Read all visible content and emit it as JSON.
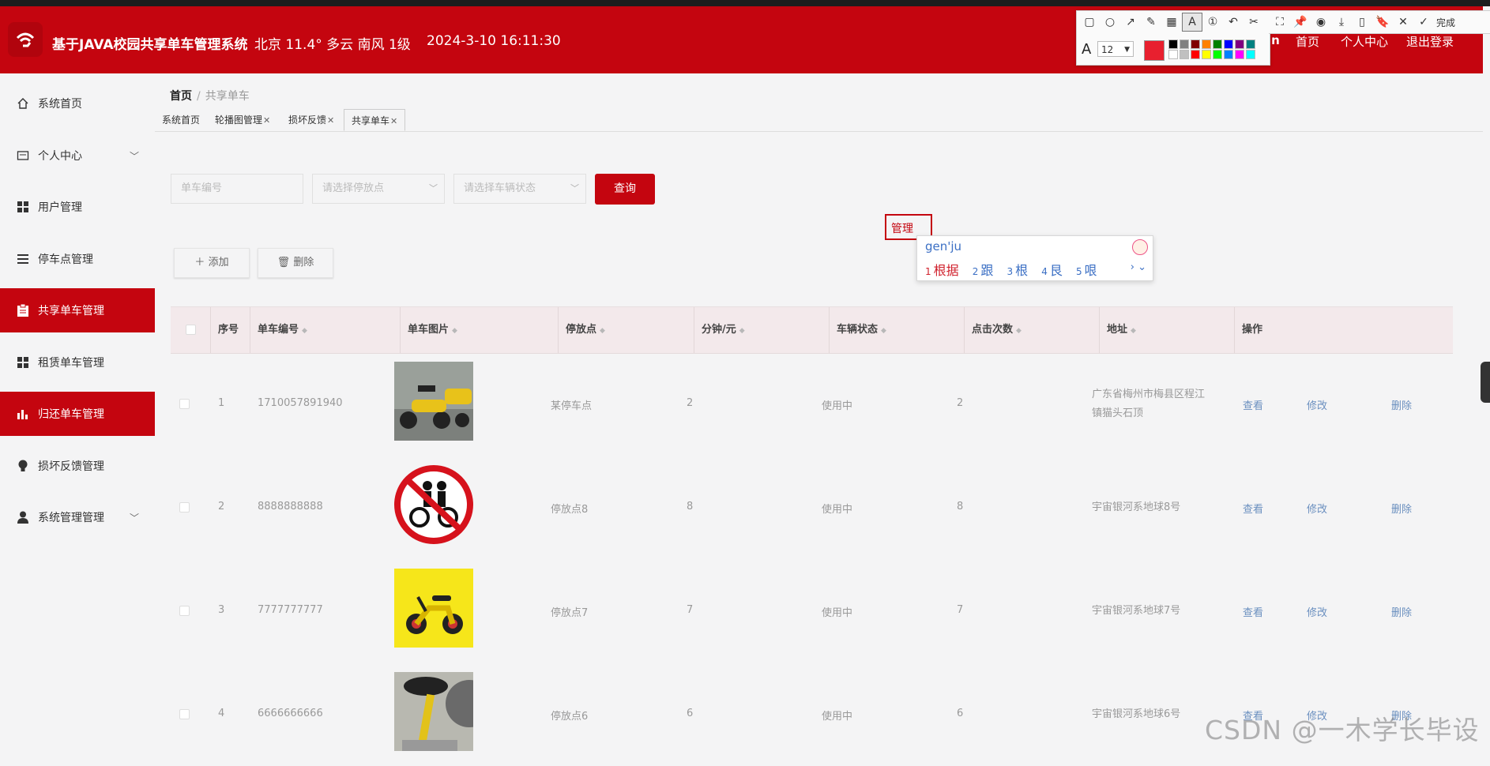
{
  "header": {
    "title": "基于JAVA校园共享单车管理系统",
    "weather": "北京  11.4°  多云  南风  1级",
    "datetime": "2024-3-10 16:11:30",
    "user_partial": "in",
    "nav": [
      "首页",
      "个人中心",
      "退出登录"
    ],
    "colors": {
      "brand": "#c4050f"
    }
  },
  "snip_tool": {
    "font_size": "12",
    "done_label": "完成",
    "current_color": "#e8202f",
    "palette": [
      "#000000",
      "#808080",
      "#800000",
      "#ff8000",
      "#008000",
      "#0000ff",
      "#800080",
      "#008080",
      "#ffffff",
      "#c0c0c0",
      "#ff0000",
      "#ffff00",
      "#00ff00",
      "#0080ff",
      "#ff00ff",
      "#00ffff"
    ]
  },
  "sidebar": {
    "items": [
      {
        "label": "系统首页",
        "icon": "home-icon"
      },
      {
        "label": "个人中心",
        "icon": "id-card-icon"
      },
      {
        "label": "用户管理",
        "icon": "grid-icon"
      },
      {
        "label": "停车点管理",
        "icon": "list-icon"
      },
      {
        "label": "共享单车管理",
        "icon": "clipboard-icon"
      },
      {
        "label": "租赁单车管理",
        "icon": "grid-icon"
      },
      {
        "label": "归还单车管理",
        "icon": "bar-chart-icon"
      },
      {
        "label": "损坏反馈管理",
        "icon": "bulb-icon"
      },
      {
        "label": "系统管理管理",
        "icon": "user-icon"
      }
    ]
  },
  "breadcrumb": {
    "home": "首页",
    "sep": "/",
    "current": "共享单车"
  },
  "tabs": [
    {
      "label": "系统首页"
    },
    {
      "label": "轮播图管理"
    },
    {
      "label": "损坏反馈"
    },
    {
      "label": "共享单车"
    }
  ],
  "search": {
    "bike_no_placeholder": "单车编号",
    "parking_placeholder": "请选择停放点",
    "status_placeholder": "请选择车辆状态",
    "query_label": "查询"
  },
  "actions": {
    "add_label": "添加",
    "delete_label": "删除"
  },
  "ime": {
    "composing": "管理",
    "pinyin": "gen'ju",
    "candidates": [
      {
        "n": "1",
        "text": "根据"
      },
      {
        "n": "2",
        "text": "跟"
      },
      {
        "n": "3",
        "text": "根"
      },
      {
        "n": "4",
        "text": "艮"
      },
      {
        "n": "5",
        "text": "哏"
      }
    ]
  },
  "table": {
    "headers": [
      "序号",
      "单车编号",
      "单车图片",
      "停放点",
      "分钟/元",
      "车辆状态",
      "点击次数",
      "地址",
      "操作"
    ],
    "row_actions": [
      "查看",
      "修改",
      "删除"
    ],
    "rows": [
      {
        "index": "1",
        "bike_no": "1710057891940",
        "image": "yellow-scooters",
        "parking": "某停车点",
        "price": "2",
        "status": "使用中",
        "clicks": "2",
        "address": "广东省梅州市梅县区程江镇猫头石顶"
      },
      {
        "index": "2",
        "bike_no": "8888888888",
        "image": "no-double-riding-sign",
        "parking": "停放点8",
        "price": "8",
        "status": "使用中",
        "clicks": "8",
        "address": "宇宙银河系地球8号"
      },
      {
        "index": "3",
        "bike_no": "7777777777",
        "image": "yellow-ebike",
        "parking": "停放点7",
        "price": "7",
        "status": "使用中",
        "clicks": "7",
        "address": "宇宙银河系地球7号"
      },
      {
        "index": "4",
        "bike_no": "6666666666",
        "image": "bike-seat",
        "parking": "停放点6",
        "price": "6",
        "status": "使用中",
        "clicks": "6",
        "address": "宇宙银河系地球6号"
      }
    ]
  },
  "watermark": "CSDN @一木学长毕设"
}
